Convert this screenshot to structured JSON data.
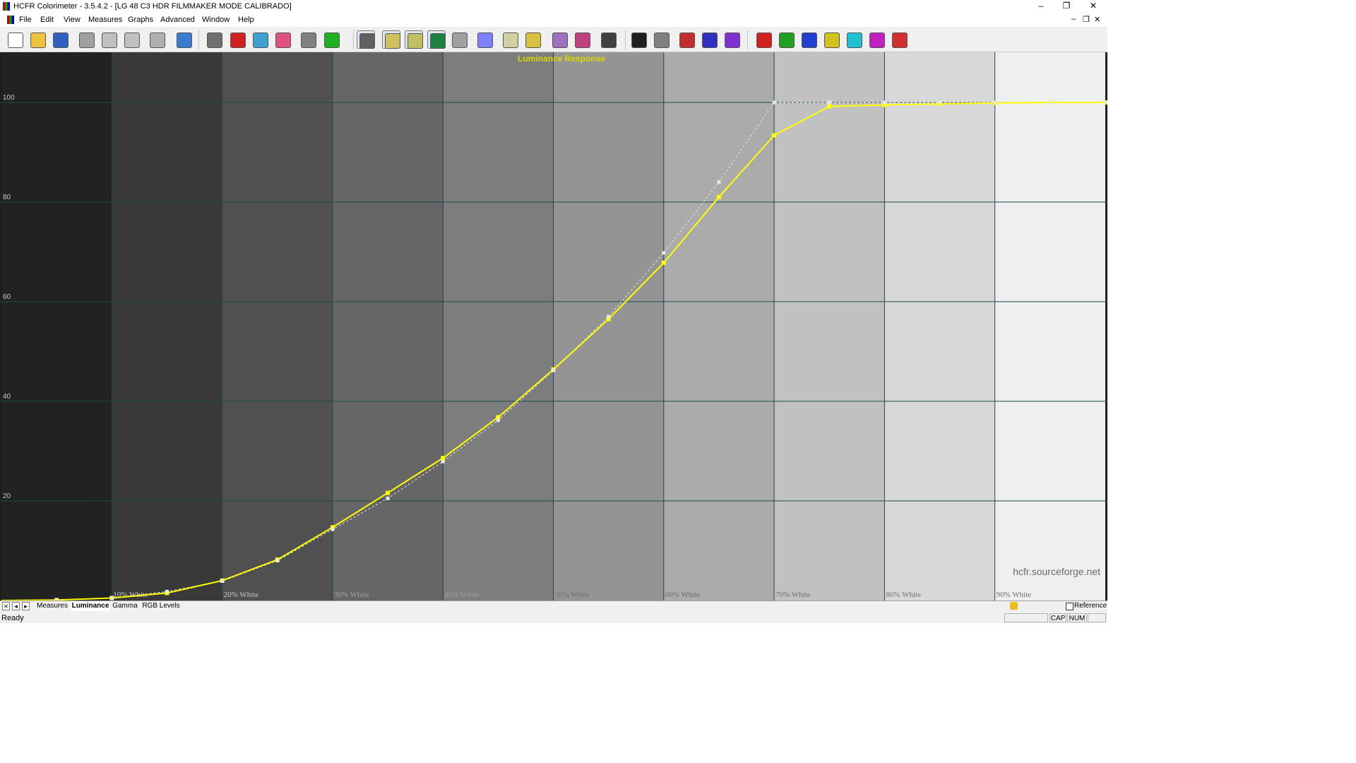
{
  "window": {
    "title": "HCFR Colorimeter - 3.5.4.2 - [LG 48 C3 HDR FILMMAKER MODE CALIBRADO]",
    "minimize": "–",
    "maximize": "❐",
    "close": "✕"
  },
  "mdi": {
    "minimize": "–",
    "restore": "❐",
    "close": "✕"
  },
  "menu": [
    "File",
    "Edit",
    "View",
    "Measures",
    "Graphs",
    "Advanced",
    "Window",
    "Help"
  ],
  "toolbar": {
    "icons": [
      "new-icon",
      "open-icon",
      "save-icon",
      "cut-icon",
      "copy-icon",
      "paste-icon",
      "print-icon",
      "help-icon",
      "sensor-icon",
      "primaries-icon",
      "secondaries-icon",
      "colors-icon",
      "camera-icon",
      "play-icon",
      "graph-cie-icon",
      "graph-luminance-icon",
      "graph-gamma-icon",
      "graph-rgb-icon",
      "graph-colortemp-icon",
      "graph-cie-chart-icon",
      "graph-saturation-icon",
      "graph-yellow-icon",
      "graph-spectrum-icon",
      "graph-deltae-icon",
      "graph-measure-icon",
      "grayscale-measure-icon",
      "grayscale-measure2-icon",
      "rgb-measure-icon",
      "rgb-measure2-icon",
      "special-measure-icon",
      "red-measure-icon",
      "green-measure-icon",
      "blue-measure-icon",
      "yellow-measure-icon",
      "cyan-measure-icon",
      "magenta-measure-icon",
      "all-colors-measure-icon"
    ],
    "colors": {
      "luminance": "#ffff00",
      "reference": "#e6e6e6",
      "title": "#d8d800"
    }
  },
  "chart_data": {
    "type": "line",
    "title": "Luminance Response",
    "watermark": "hcfr.sourceforge.net",
    "ylim": [
      0,
      105
    ],
    "xlim": [
      0,
      100
    ],
    "yticks": [
      20,
      40,
      60,
      80,
      100
    ],
    "xtick_labels": [
      "10% White",
      "20% White",
      "30% White",
      "40% White",
      "50% White",
      "60% White",
      "70% White",
      "80% White",
      "90% White"
    ],
    "x": [
      0,
      5,
      10,
      15,
      20,
      25,
      30,
      35,
      40,
      45,
      50,
      55,
      60,
      65,
      70,
      75,
      80,
      85,
      90,
      95,
      100
    ],
    "series": [
      {
        "values": [
          0,
          0.1,
          0.5,
          1.5,
          4.0,
          8.2,
          14.7,
          21.6,
          28.6,
          36.8,
          46.4,
          56.5,
          67.8,
          81.0,
          93.4,
          99.2,
          99.5,
          99.7,
          99.9,
          100,
          100
        ]
      },
      {
        "values": [
          0,
          0.1,
          0.5,
          1.8,
          3.9,
          8.0,
          14.3,
          20.5,
          27.9,
          36.2,
          46.2,
          57.0,
          69.8,
          84.0,
          100,
          100,
          100,
          100,
          100,
          100,
          100
        ]
      }
    ],
    "legend": "none",
    "grid": true
  },
  "tabs": [
    "Measures",
    "Luminance",
    "Gamma",
    "RGB Levels"
  ],
  "nav": [
    "⨯",
    "◂",
    "▸"
  ],
  "reference_label": "Reference",
  "status": {
    "text": "Ready",
    "cap": "CAP",
    "num": "NUM"
  }
}
